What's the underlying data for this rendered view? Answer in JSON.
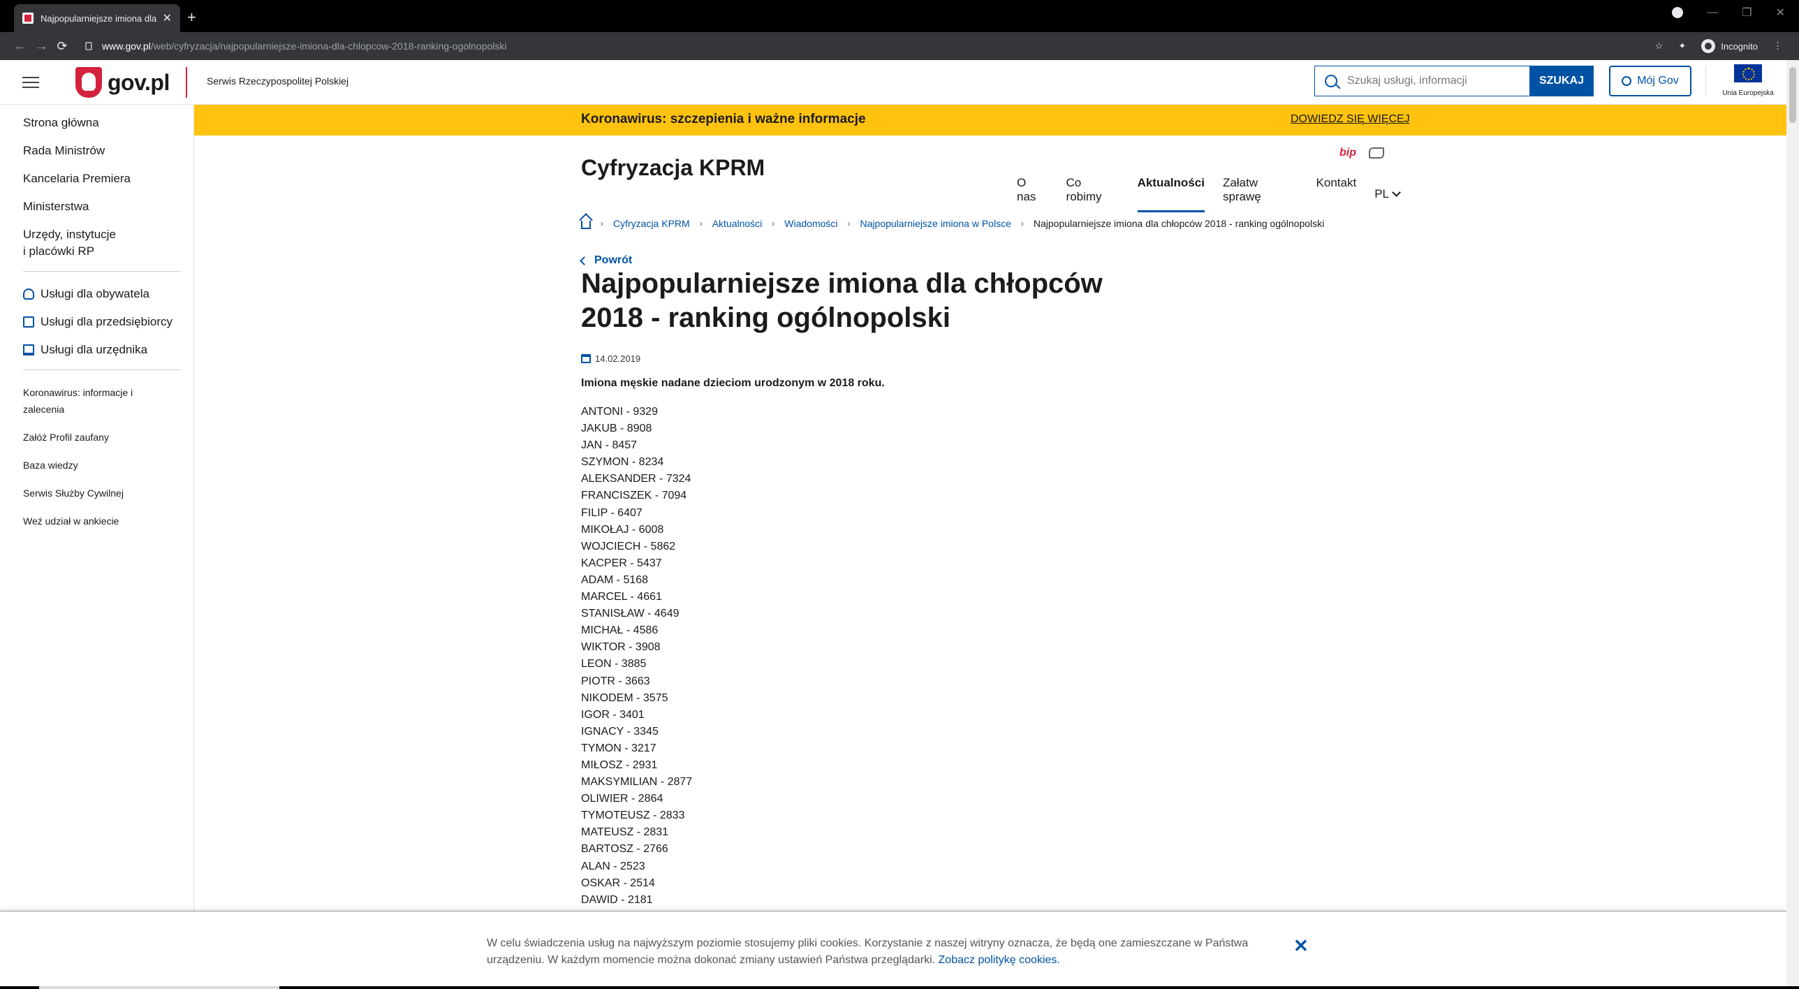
{
  "browser": {
    "tab_title": "Najpopularniejsze imiona dla chł",
    "tab_close": "✕",
    "new_tab": "+",
    "url_host": "www.gov.pl",
    "url_path": "/web/cyfryzacja/najpopularniejsze-imiona-dla-chlopcow-2018-ranking-ogolnopolski",
    "profile_label": "Incognito",
    "win_min": "—",
    "win_max": "❐",
    "win_close": "✕"
  },
  "header": {
    "logo_text": "gov.pl",
    "service_name": "Serwis Rzeczypospolitej Polskiej",
    "search_placeholder": "Szukaj usługi, informacji",
    "search_button": "SZUKAJ",
    "moj_gov": "Mój Gov",
    "eu_label": "Unia Europejska"
  },
  "sidebar": {
    "main": [
      "Strona główna",
      "Rada Ministrów",
      "Kancelaria Premiera",
      "Ministerstwa",
      "Urzędy, instytucje",
      "i placówki RP"
    ],
    "services": [
      "Usługi dla obywatela",
      "Usługi dla przedsiębiorcy",
      "Usługi dla urzędnika"
    ],
    "extra": [
      "Koronawirus: informacje i zalecenia",
      "Załóż Profil zaufany",
      "Baza wiedzy",
      "Serwis Służby Cywilnej",
      "Weź udział w ankiecie"
    ]
  },
  "alert": {
    "title": "Koronawirus: szczepienia i ważne informacje",
    "link": "DOWIEDZ SIĘ WIĘCEJ"
  },
  "page": {
    "bip": "bip",
    "dept_title": "Cyfryzacja KPRM",
    "nav": [
      "O nas",
      "Co robimy",
      "Aktualności",
      "Załatw sprawę",
      "Kontakt"
    ],
    "lang": "PL",
    "breadcrumb": [
      "Cyfryzacja KPRM",
      "Aktualności",
      "Wiadomości",
      "Najpopularniejsze imiona w Polsce"
    ],
    "breadcrumb_current": "Najpopularniejsze imiona dla chłopców 2018 - ranking ogólnopolski",
    "back": "Powrót",
    "title": "Najpopularniejsze imiona dla chłopców 2018 - ranking ogólnopolski",
    "date": "14.02.2019",
    "lead": "Imiona męskie nadane dzieciom urodzonym w 2018 roku.",
    "names": [
      "ANTONI - 9329",
      "JAKUB - 8908",
      "JAN - 8457",
      "SZYMON - 8234",
      "ALEKSANDER - 7324",
      "FRANCISZEK - 7094",
      "FILIP - 6407",
      "MIKOŁAJ - 6008",
      "WOJCIECH - 5862",
      "KACPER - 5437",
      "ADAM - 5168",
      "MARCEL - 4661",
      "STANISŁAW - 4649",
      "MICHAŁ - 4586",
      "WIKTOR - 3908",
      "LEON - 3885",
      "PIOTR - 3663",
      "NIKODEM - 3575",
      "IGOR - 3401",
      "IGNACY - 3345",
      "TYMON - 3217",
      "MIŁOSZ - 2931",
      "MAKSYMILIAN - 2877",
      "OLIWIER - 2864",
      "TYMOTEUSZ - 2833",
      "MATEUSZ - 2831",
      "BARTOSZ - 2766",
      "ALAN - 2523",
      "OSKAR - 2514",
      "DAWID - 2181"
    ]
  },
  "cookie": {
    "text": "W celu świadczenia usług na najwyższym poziomie stosujemy pliki cookies. Korzystanie z naszej witryny oznacza, że będą one zamieszczane w Państwa urządzeniu. W każdym momencie można dokonać zmiany ustawień Państwa przeglądarki.",
    "link": "Zobacz politykę cookies.",
    "close": "✕"
  },
  "colors": {
    "brand_blue": "#0052a5",
    "alert_yellow": "#ffc20e",
    "gov_red": "#d4213d"
  }
}
